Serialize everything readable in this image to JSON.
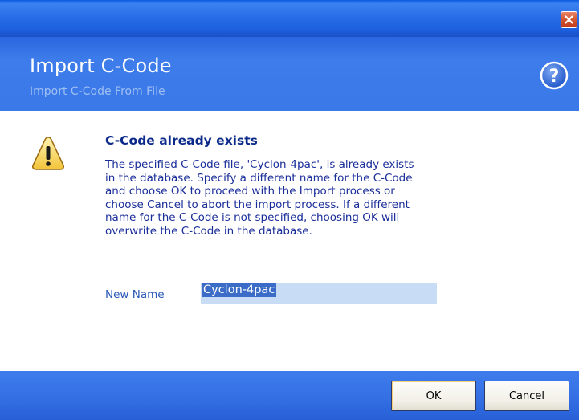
{
  "window": {
    "close_icon": "close-icon"
  },
  "header": {
    "title": "Import C-Code",
    "subtitle": "Import C-Code From File",
    "help_icon": "help-icon"
  },
  "message": {
    "icon": "warning-icon",
    "title": "C-Code already exists",
    "body": "The specified C-Code file, 'Cyclon-4pac', is already exists\nin the database. Specify a different name for the C-Code\nand choose OK to proceed with the Import process or\nchoose Cancel to abort the import process. If a different\nname for the C-Code is not specified, choosing OK will\noverwrite the C-Code in the database."
  },
  "form": {
    "new_name_label": "New Name",
    "new_name_value": "Cyclon-4pac"
  },
  "buttons": {
    "ok_label": "OK",
    "cancel_label": "Cancel"
  },
  "colors": {
    "header_blue": "#3b78e8",
    "title_text": "#0b2a8a",
    "body_text": "#1a2e9a",
    "input_bg": "#c9dcf6",
    "selection": "#3b6cc8"
  }
}
